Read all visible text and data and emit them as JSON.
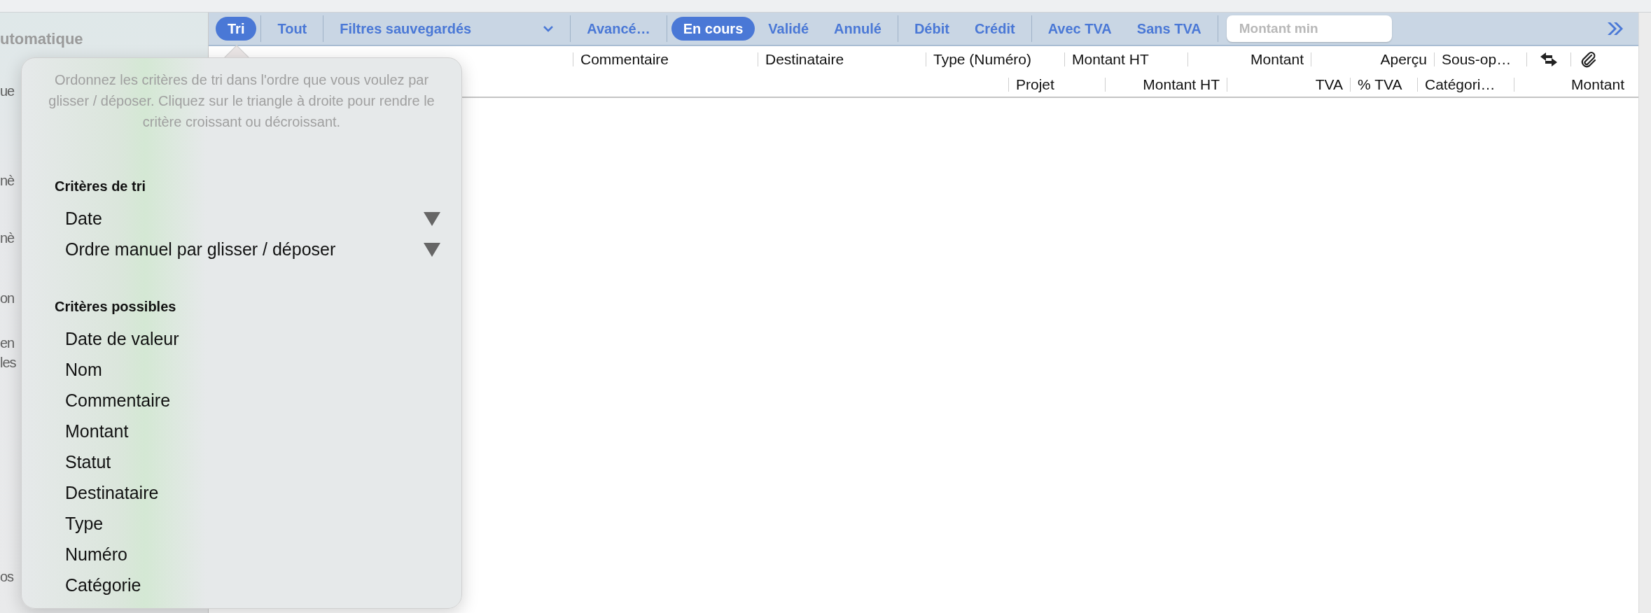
{
  "sidebar": {
    "items": [
      {
        "label": "utomatique",
        "kind": "heading"
      },
      {
        "label": "ue",
        "kind": "item"
      },
      {
        "label": "nè",
        "kind": "item"
      },
      {
        "label": "nè",
        "kind": "item"
      },
      {
        "label": "on",
        "kind": "item"
      },
      {
        "label": "en",
        "kind": "item"
      },
      {
        "label": "les",
        "kind": "item"
      },
      {
        "label": "os",
        "kind": "item"
      }
    ]
  },
  "toolbar": {
    "groups": [
      [
        {
          "label": "Tri",
          "kind": "pill",
          "selected": true
        }
      ],
      [
        {
          "label": "Tout",
          "kind": "pill",
          "selected": false
        }
      ],
      [
        {
          "label": "Filtres sauvegardés",
          "kind": "dropdown",
          "selected": false
        }
      ],
      [
        {
          "label": "Avancé…",
          "kind": "pill",
          "selected": false
        }
      ],
      [
        {
          "label": "En cours",
          "kind": "pill",
          "selected": true
        },
        {
          "label": "Validé",
          "kind": "pill",
          "selected": false
        },
        {
          "label": "Annulé",
          "kind": "pill",
          "selected": false
        }
      ],
      [
        {
          "label": "Débit",
          "kind": "pill",
          "selected": false
        },
        {
          "label": "Crédit",
          "kind": "pill",
          "selected": false
        }
      ],
      [
        {
          "label": "Avec TVA",
          "kind": "pill",
          "selected": false
        },
        {
          "label": "Sans TVA",
          "kind": "pill",
          "selected": false
        }
      ]
    ],
    "amount_field": {
      "placeholder": "Montant min"
    }
  },
  "table": {
    "header_row_1": [
      "Commentaire",
      "Destinataire",
      "Type (Numéro)",
      "Montant HT",
      "Montant",
      "Aperçu",
      "Sous-op…"
    ],
    "header_row_2": [
      "Projet",
      "Montant HT",
      "TVA",
      "% TVA",
      "Catégori…",
      "Montant"
    ]
  },
  "sort_popover": {
    "hint": "Ordonnez les critères de tri dans l'ordre que vous voulez par glisser / déposer. Cliquez sur le triangle à droite pour rendre le critère croissant ou décroissant.",
    "sections": [
      {
        "title": "Critères de tri",
        "items": [
          {
            "label": "Date",
            "descending": true
          },
          {
            "label": "Ordre manuel par glisser / déposer",
            "descending": true
          }
        ]
      },
      {
        "title": "Critères possibles",
        "items": [
          {
            "label": "Date de valeur"
          },
          {
            "label": "Nom"
          },
          {
            "label": "Commentaire"
          },
          {
            "label": "Montant"
          },
          {
            "label": "Statut"
          },
          {
            "label": "Destinataire"
          },
          {
            "label": "Type"
          },
          {
            "label": "Numéro"
          },
          {
            "label": "Catégorie"
          }
        ]
      }
    ]
  }
}
